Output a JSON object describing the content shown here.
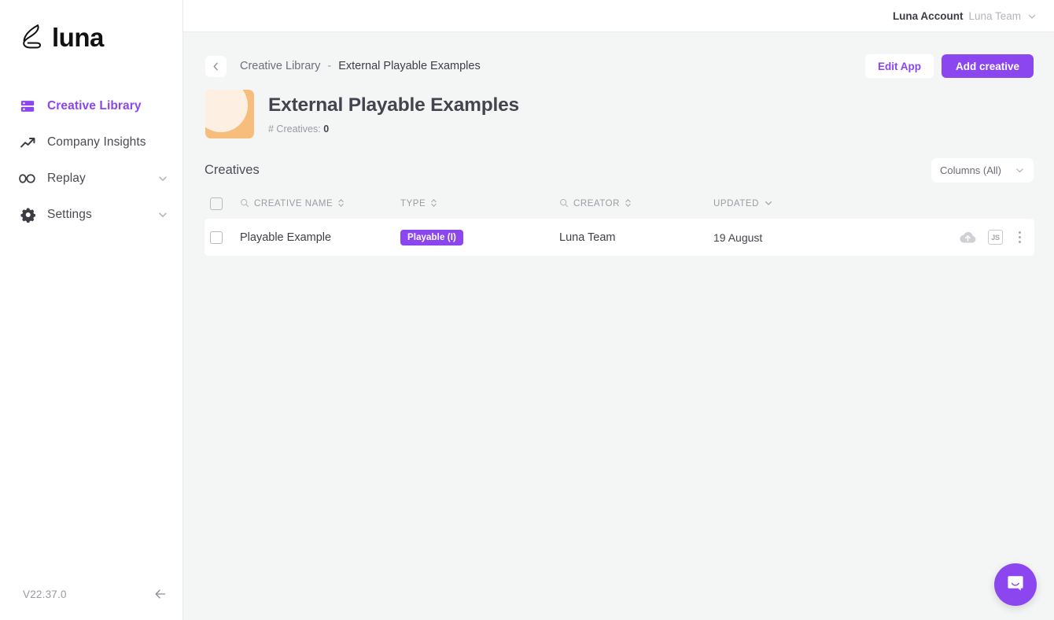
{
  "brand": {
    "name": "luna",
    "logo_icon": "luna-crescent-logo",
    "accent_color": "#8b46f0"
  },
  "sidebar": {
    "items": [
      {
        "label": "Creative Library",
        "icon": "server-icon",
        "active": true,
        "expandable": false
      },
      {
        "label": "Company Insights",
        "icon": "trending-up-icon",
        "active": false,
        "expandable": false
      },
      {
        "label": "Replay",
        "icon": "infinity-icon",
        "active": false,
        "expandable": true
      },
      {
        "label": "Settings",
        "icon": "gear-icon",
        "active": false,
        "expandable": true
      }
    ],
    "version": "V22.37.0",
    "collapse_icon": "arrow-left-icon"
  },
  "topbar": {
    "account_label": "Luna Account",
    "team_label": "Luna Team",
    "caret_icon": "chevron-down-icon"
  },
  "breadcrumb": {
    "back_icon": "chevron-left-icon",
    "parent": "Creative Library",
    "separator": "-",
    "current": "External Playable Examples"
  },
  "actions": {
    "edit_app_label": "Edit App",
    "add_creative_label": "Add creative"
  },
  "page": {
    "thumbnail_icon": "app-thumbnail",
    "title": "External Playable Examples",
    "creatives_count_label": "# Creatives:",
    "creatives_count": "0"
  },
  "creatives_section": {
    "title": "Creatives",
    "columns_select_label": "Columns (All)",
    "columns_caret_icon": "chevron-down-icon"
  },
  "table": {
    "headers": {
      "creative_name": "CREATIVE NAME",
      "type": "TYPE",
      "creator": "CREATOR",
      "updated": "UPDATED"
    },
    "rows": [
      {
        "name": "Playable Example",
        "type_badge": "Playable (I)",
        "creator": "Luna Team",
        "updated": "19 August",
        "actions": {
          "upload_icon": "cloud-upload-icon",
          "format_chip": "JS",
          "menu_icon": "kebab-menu-icon"
        }
      }
    ]
  },
  "chat": {
    "launcher_icon": "chat-bubble-icon"
  }
}
